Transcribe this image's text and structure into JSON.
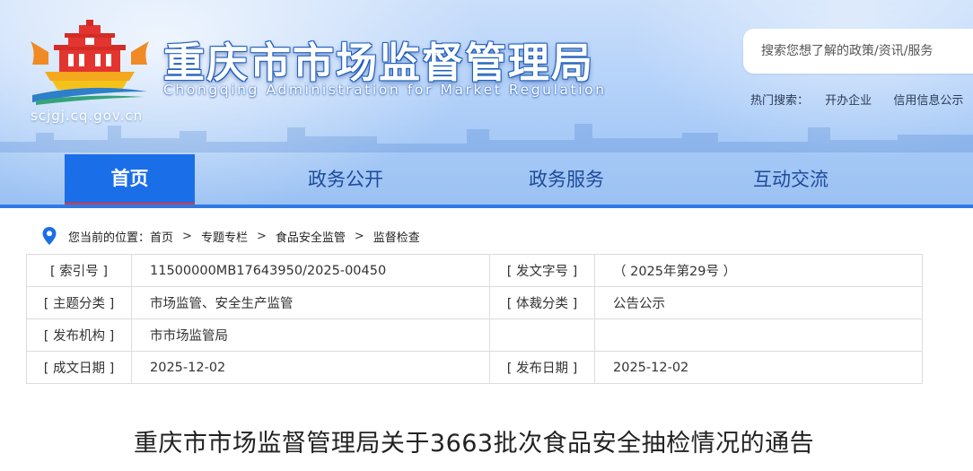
{
  "header": {
    "site_title": "重庆市市场监督管理局",
    "site_subtitle": "Chongqing  Administration for Market Regulation",
    "domain": "scjgj.cq.gov.cn",
    "search_placeholder": "搜索您想了解的政策/资讯/服务",
    "hot_label": "热门搜索：",
    "hot_links": [
      "开办企业",
      "信用信息公示"
    ]
  },
  "nav": {
    "items": [
      "首页",
      "政务公开",
      "政务服务",
      "互动交流"
    ],
    "active_index": 0
  },
  "breadcrumb": {
    "prefix": "您当前的位置：",
    "items": [
      "首页",
      "专题专栏",
      "食品安全监管",
      "监督检查"
    ],
    "separator": ">"
  },
  "meta_table": {
    "rows": [
      {
        "k1": "[ 索引号 ]",
        "v1": "11500000MB17643950/2025-00450",
        "k2": "[ 发文字号 ]",
        "v2": "（ 2025年第29号 ）"
      },
      {
        "k1": "[ 主题分类 ]",
        "v1": "市场监管、安全生产监管",
        "k2": "[ 体裁分类 ]",
        "v2": "公告公示"
      },
      {
        "k1": "[ 发布机构 ]",
        "v1": "市市场监管局",
        "k2": "",
        "v2": ""
      },
      {
        "k1": "[ 成文日期 ]",
        "v1": "2025-12-02",
        "k2": "[ 发布日期 ]",
        "v2": "2025-12-02"
      }
    ]
  },
  "document": {
    "title": "重庆市市场监督管理局关于3663批次食品安全抽检情况的通告"
  },
  "colors": {
    "nav_active": "#1a6ee8",
    "nav_text": "#1d4b9a",
    "accent_red": "#e33333",
    "banner": "#b8d4fa"
  }
}
